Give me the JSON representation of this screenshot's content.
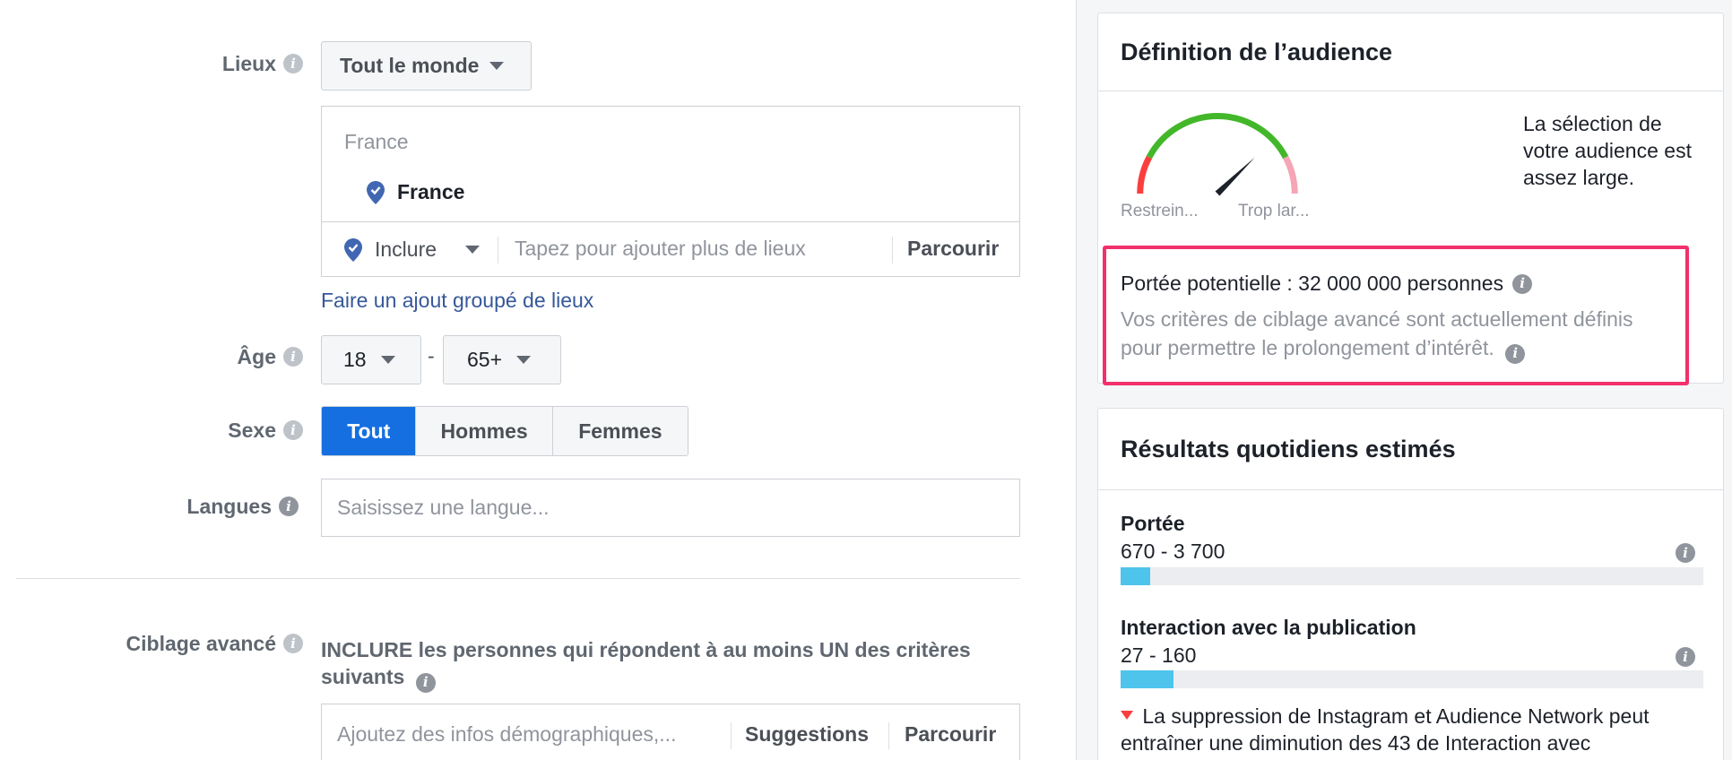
{
  "form": {
    "locations": {
      "label": "Lieux",
      "scope": "Tout le monde",
      "search_value": "France",
      "selected": "France",
      "include_label": "Inclure",
      "input_placeholder": "Tapez pour ajouter plus de lieux",
      "browse": "Parcourir",
      "bulk_link": "Faire un ajout groupé de lieux"
    },
    "age": {
      "label": "Âge",
      "min": "18",
      "separator": "-",
      "max": "65+"
    },
    "gender": {
      "label": "Sexe",
      "options": [
        "Tout",
        "Hommes",
        "Femmes"
      ]
    },
    "languages": {
      "label": "Langues",
      "placeholder": "Saisissez une langue..."
    },
    "detailed": {
      "label": "Ciblage avancé",
      "include_text": "INCLURE les personnes qui répondent à au moins UN des critères suivants",
      "input_placeholder": "Ajoutez des infos démographiques,...",
      "suggestions": "Suggestions",
      "browse": "Parcourir"
    }
  },
  "audience": {
    "title": "Définition de l’audience",
    "gauge_left": "Restrein...",
    "gauge_right": "Trop lar...",
    "gauge_level": 0.78,
    "description": "La sélection de votre audience est assez large.",
    "potential_reach": "Portée potentielle : 32 000 000 personnes",
    "note": "Vos critères de ciblage avancé sont actuellement définis pour permettre le prolongement d’intérêt."
  },
  "estimated": {
    "title": "Résultats quotidiens estimés",
    "reach_label": "Portée",
    "reach_value": "670 - 3 700",
    "reach_fill": 0.05,
    "interaction_label": "Interaction avec la publication",
    "interaction_value": "27 - 160",
    "interaction_fill": 0.09,
    "warning": "La suppression de Instagram et Audience Network peut entraîner une diminution des 43 de Interaction avec"
  },
  "colors": {
    "primary": "#166fe0",
    "link": "#365899",
    "highlight": "#f2306b",
    "bar": "#4ec4ec",
    "gauge_green": "#42b72a",
    "gauge_red": "#fa3e3e",
    "gauge_pink": "#f5a5b5"
  }
}
